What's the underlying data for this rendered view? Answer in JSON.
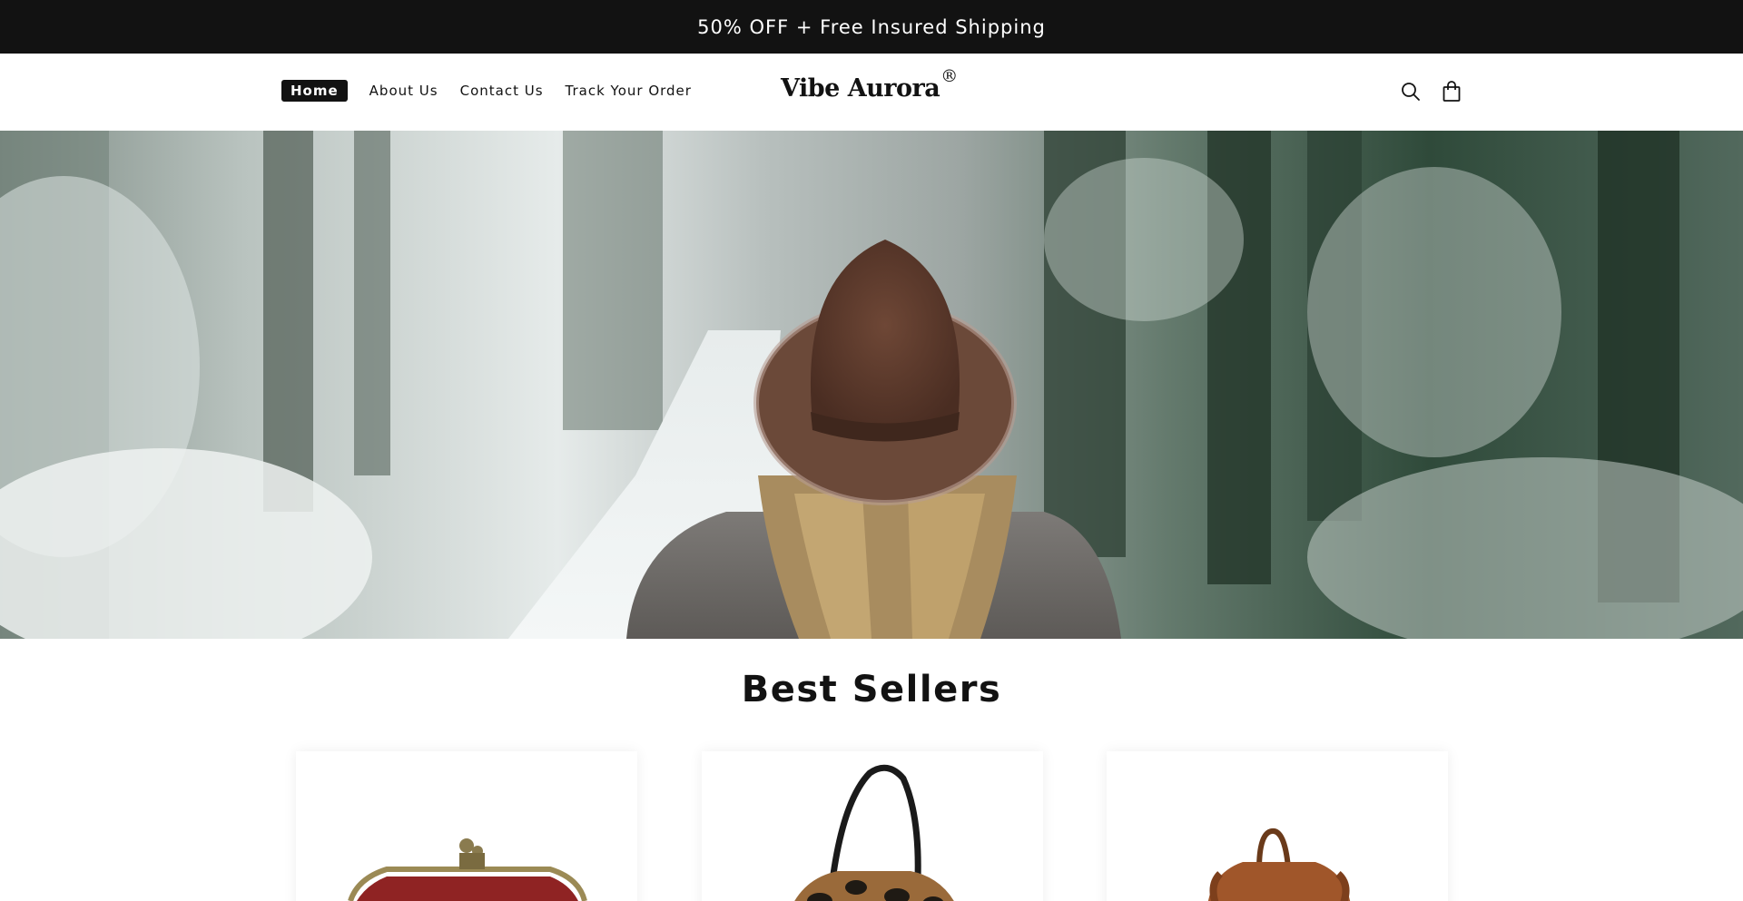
{
  "announcement": {
    "text": "50% OFF + Free Insured Shipping"
  },
  "header": {
    "nav": [
      {
        "label": "Home",
        "active": true
      },
      {
        "label": "About Us",
        "active": false
      },
      {
        "label": "Contact Us",
        "active": false
      },
      {
        "label": "Track Your Order",
        "active": false
      }
    ],
    "logo": {
      "text": "Vibe Aurora",
      "mark": "®"
    },
    "icons": [
      "search-icon",
      "shopping-bag-icon"
    ]
  },
  "hero": {
    "image": "woman in brown hat walking through snowy forest"
  },
  "best_sellers": {
    "title": "Best Sellers",
    "products": [
      {
        "image": "red leather clasp purse"
      },
      {
        "image": "leopard print handbag"
      },
      {
        "image": "brown leather backpack"
      }
    ]
  },
  "colors": {
    "dark": "#121212",
    "background": "#ffffff"
  }
}
